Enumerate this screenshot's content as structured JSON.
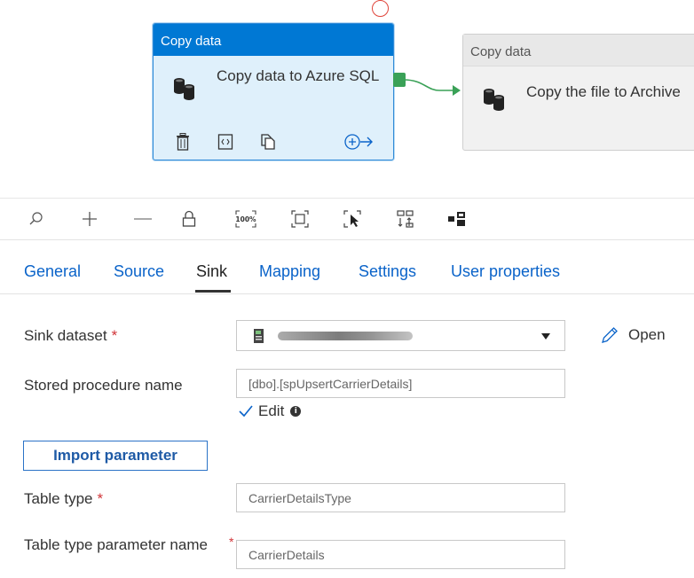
{
  "canvas": {
    "activity1": {
      "header": "Copy data",
      "title": "Copy data to Azure SQL",
      "icons": [
        "database-icon",
        "delete-icon",
        "code-icon",
        "copy-icon",
        "add-output-icon"
      ]
    },
    "activity2": {
      "header": "Copy data",
      "title": "Copy the file to Archive",
      "icons": [
        "database-icon"
      ]
    },
    "colors": {
      "selected_header": "#0078d4",
      "selected_body": "#dff0fb",
      "success_port": "#3aa157",
      "error_marker": "#e0453b"
    }
  },
  "toolbar": {
    "buttons": [
      "search-icon",
      "zoom-in-icon",
      "zoom-out-icon",
      "lock-icon",
      "zoom-100-icon",
      "fit-to-screen-icon",
      "select-mode-icon",
      "auto-align-icon",
      "layout-icon"
    ],
    "zoom_label": "100%"
  },
  "tabs": [
    {
      "label": "General"
    },
    {
      "label": "Source"
    },
    {
      "label": "Sink",
      "active": true
    },
    {
      "label": "Mapping"
    },
    {
      "label": "Settings"
    },
    {
      "label": "User properties"
    }
  ],
  "form": {
    "sink_dataset_label": "Sink dataset",
    "required_mark": "*",
    "open_label": "Open",
    "stored_procedure_label": "Stored procedure name",
    "stored_procedure_value": "[dbo].[spUpsertCarrierDetails]",
    "edit_label": "Edit",
    "edit_checked": true,
    "info_glyph": "i",
    "import_button": "Import parameter",
    "table_type_label": "Table type",
    "table_type_value": "CarrierDetailsType",
    "table_type_param_label": "Table type parameter name",
    "table_type_param_value": "CarrierDetails"
  }
}
